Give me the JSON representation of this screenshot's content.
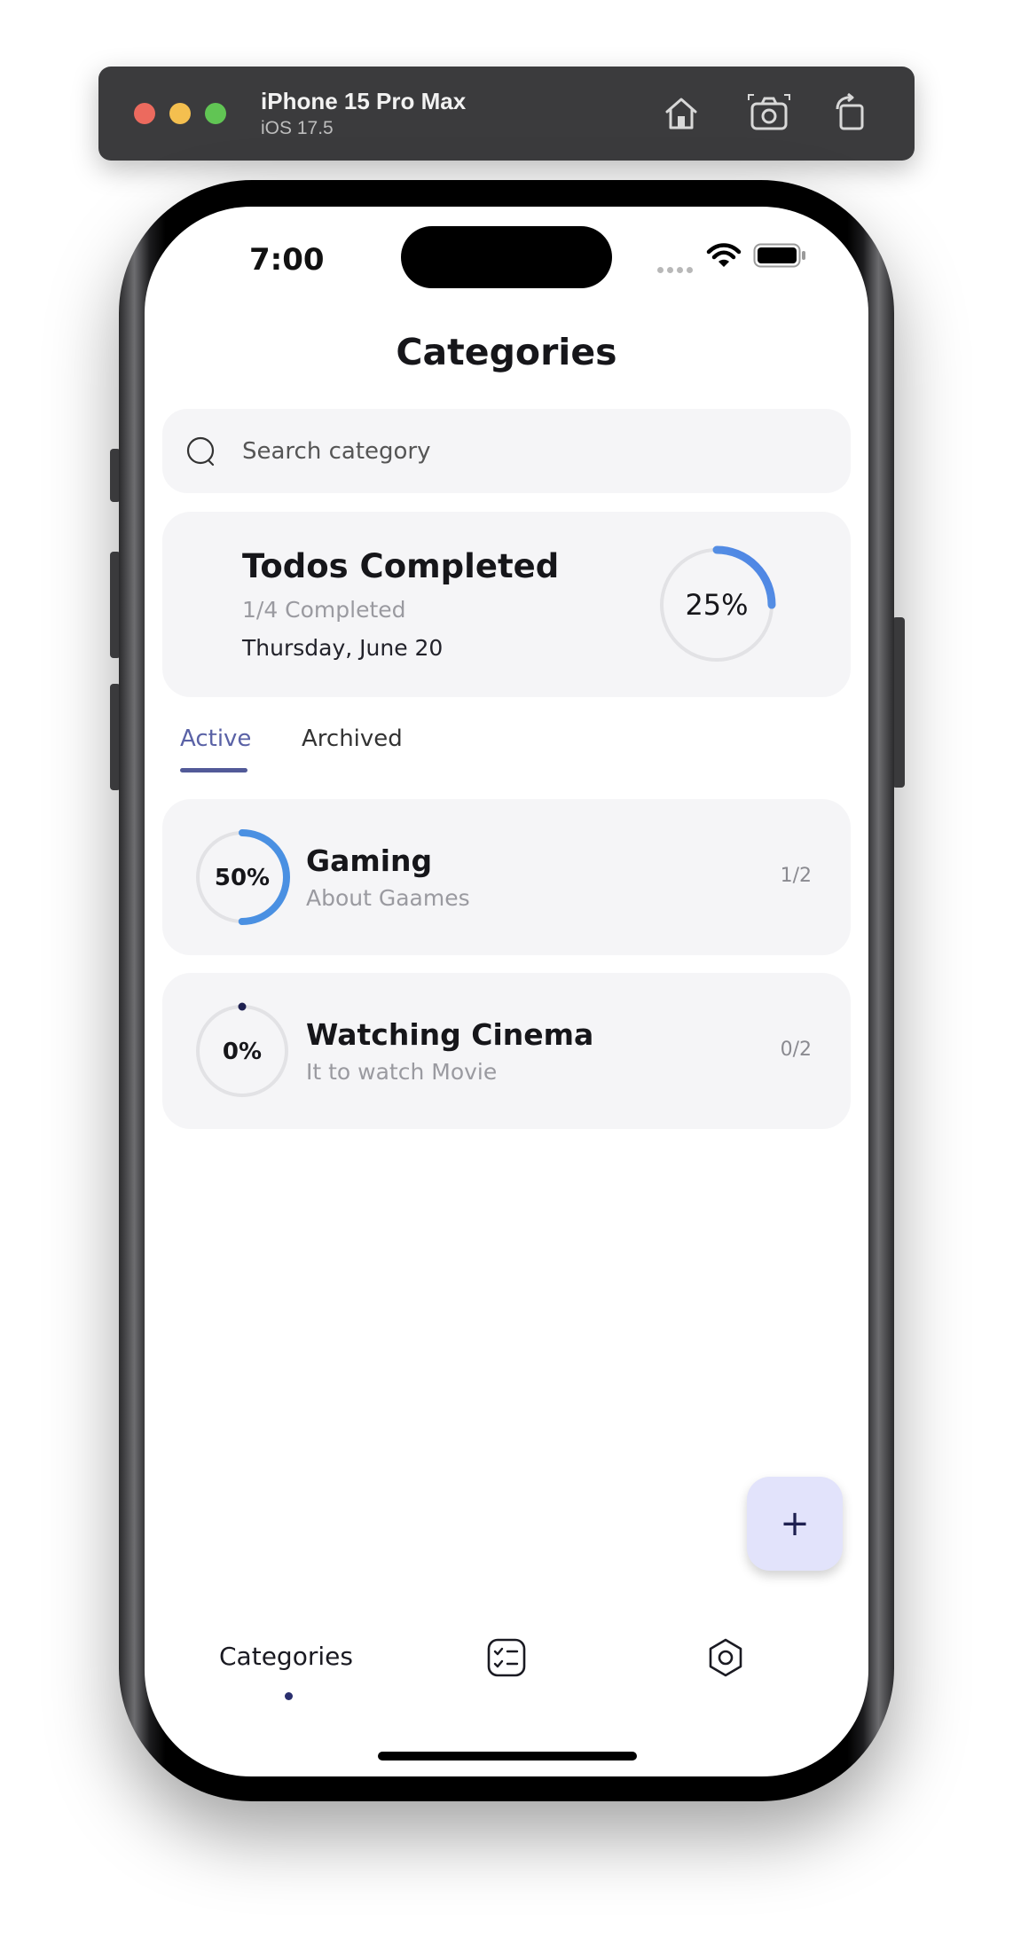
{
  "simulator": {
    "device_name": "iPhone 15 Pro Max",
    "os_version": "iOS 17.5",
    "icons": [
      "home-icon",
      "screenshot-icon",
      "rotate-icon"
    ]
  },
  "status_bar": {
    "time": "7:00",
    "icons": [
      "signal-icon",
      "wifi-icon",
      "battery-icon"
    ]
  },
  "header": {
    "title": "Categories"
  },
  "search": {
    "placeholder": "Search category",
    "value": ""
  },
  "summary": {
    "title": "Todos Completed",
    "progress_text": "1/4 Completed",
    "date": "Thursday, June 20",
    "percent_label": "25%",
    "percent": 25
  },
  "tabs": [
    {
      "label": "Active",
      "selected": true
    },
    {
      "label": "Archived",
      "selected": false
    }
  ],
  "categories": [
    {
      "name": "Gaming",
      "description": "About Gaames",
      "count": "1/2",
      "percent_label": "50%",
      "percent": 50
    },
    {
      "name": "Watching Cinema",
      "description": "It to watch Movie",
      "count": "0/2",
      "percent_label": "0%",
      "percent": 0
    }
  ],
  "fab": {
    "label": "+"
  },
  "bottom_nav": {
    "items": [
      {
        "label": "Categories",
        "icon": "",
        "selected": true
      },
      {
        "label": "",
        "icon": "checklist-icon",
        "selected": false
      },
      {
        "label": "",
        "icon": "settings-icon",
        "selected": false
      }
    ]
  },
  "colors": {
    "accent": "#5a62a6",
    "progress": "#4a90e2",
    "progress_start": "#6fb8dc",
    "card_bg": "#f5f5f7",
    "track": "#e2e2e5",
    "fab_bg": "#e2e3fb"
  }
}
